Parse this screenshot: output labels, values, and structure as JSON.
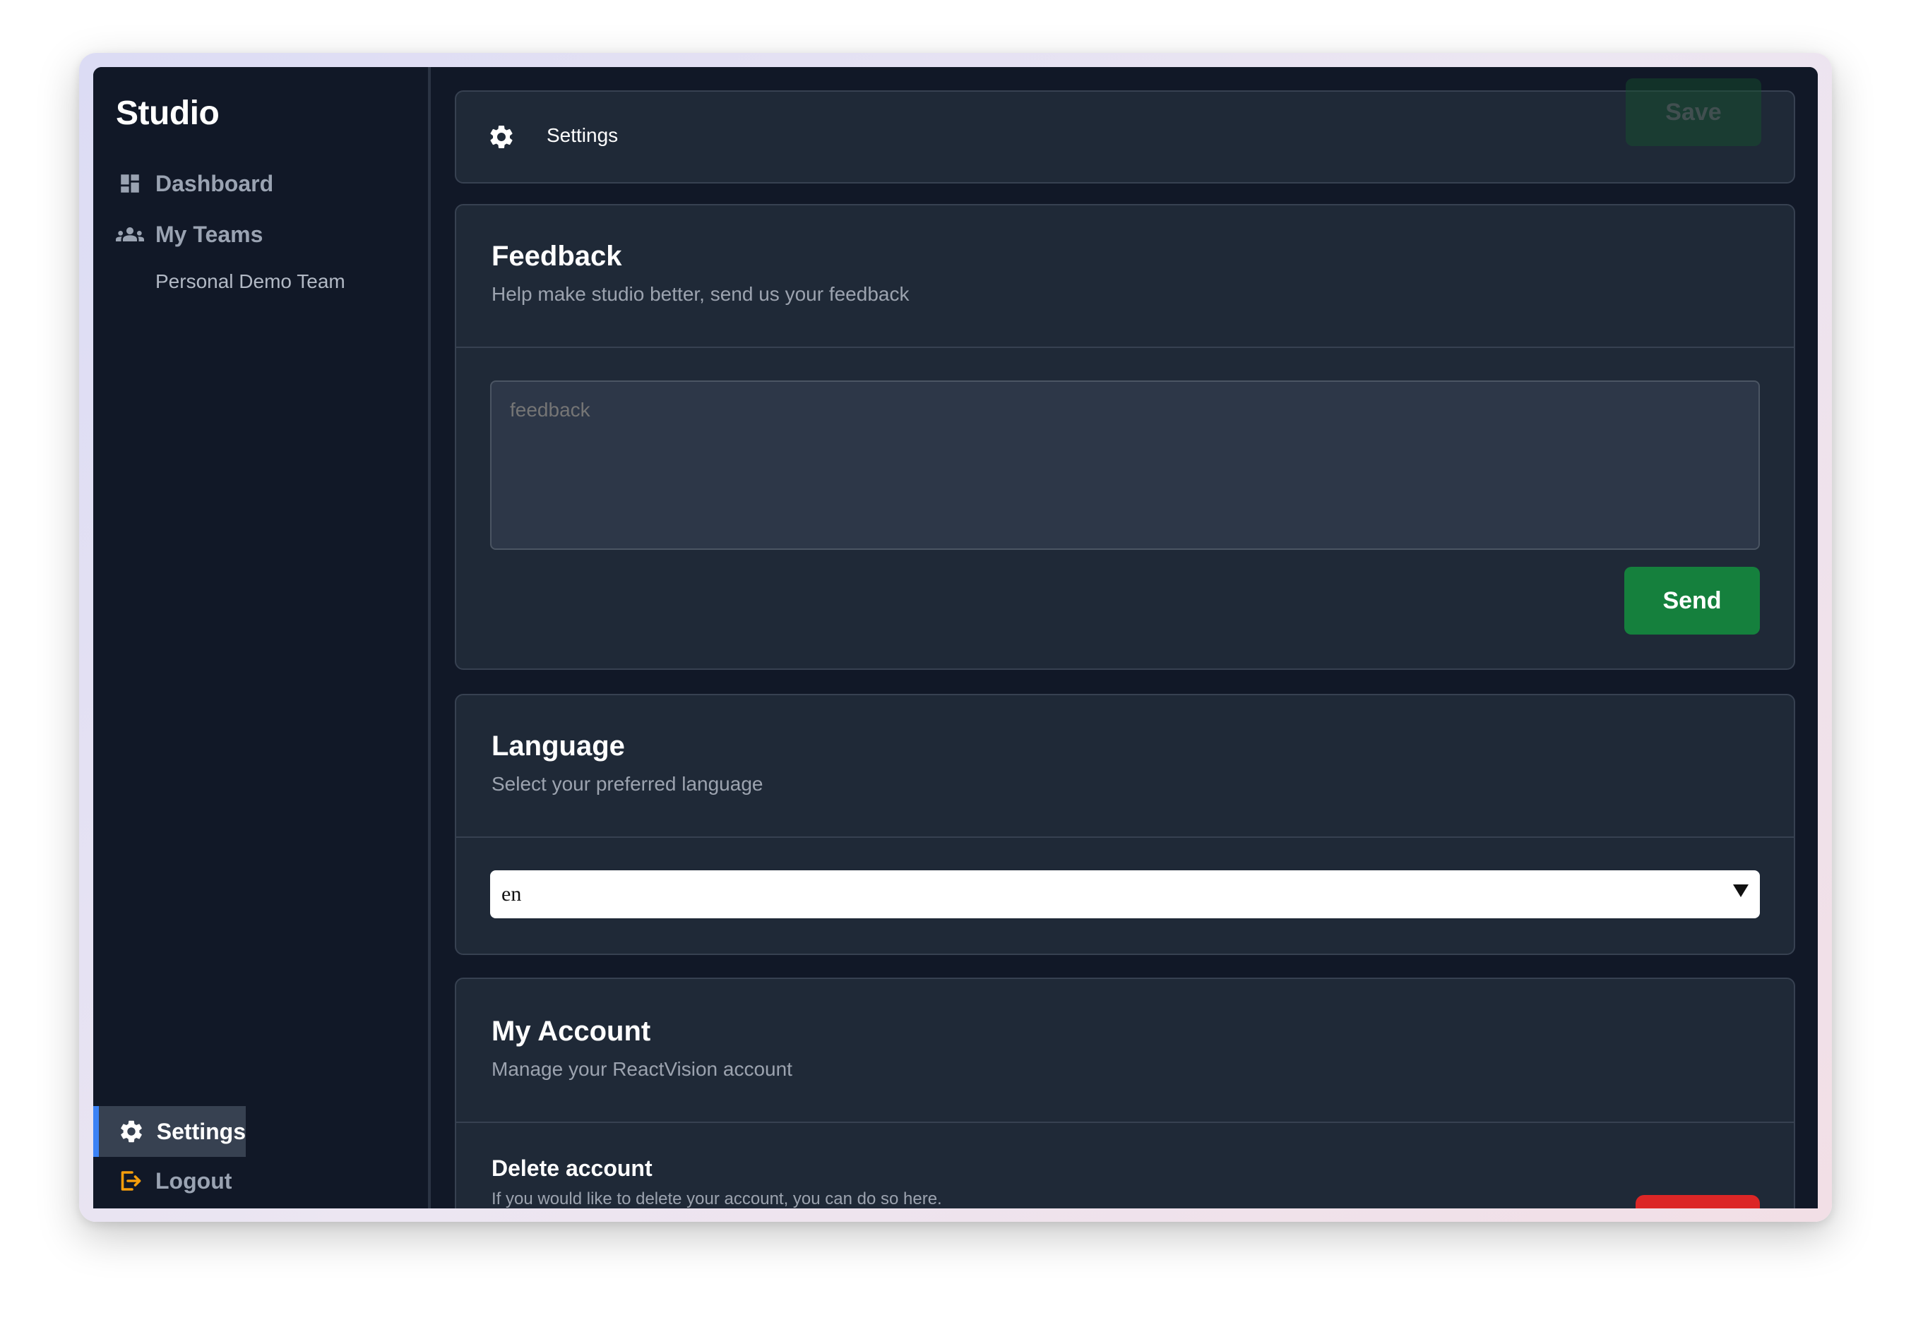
{
  "sidebar": {
    "brand": "Studio",
    "items": [
      {
        "label": "Dashboard",
        "icon": "dashboard-icon"
      },
      {
        "label": "My Teams",
        "icon": "users-icon"
      }
    ],
    "subitem": "Personal Demo Team",
    "settings_label": "Settings",
    "logout_label": "Logout"
  },
  "header": {
    "title": "Settings",
    "save_label": "Save"
  },
  "feedback": {
    "title": "Feedback",
    "subtitle": "Help make studio better, send us your feedback",
    "placeholder": "feedback",
    "send_label": "Send"
  },
  "language": {
    "title": "Language",
    "subtitle": "Select your preferred language",
    "selected": "en"
  },
  "account": {
    "title": "My Account",
    "subtitle": "Manage your ReactVision account",
    "delete_title": "Delete account",
    "delete_subtitle": "If you would like to delete your account, you can do so here."
  },
  "colors": {
    "accent": "#3b82f6",
    "send": "#15803d",
    "danger": "#dc2626",
    "logout_icon": "#f59e0b"
  }
}
